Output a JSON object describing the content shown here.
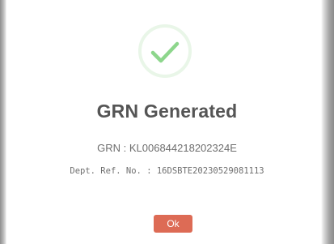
{
  "dialog": {
    "icon": "success-checkmark-icon",
    "title": "GRN Generated",
    "grn_label": "GRN :",
    "grn_value": "KL006844218202324E",
    "dept_ref_label": "Dept. Ref. No. :",
    "dept_ref_value": "16DSBTE20230529081113",
    "ok_label": "Ok"
  },
  "colors": {
    "check": "#8dd68c",
    "ring": "#e9f6e8",
    "button": "#dd6b55",
    "title": "#555555",
    "text": "#6e6e6e"
  }
}
